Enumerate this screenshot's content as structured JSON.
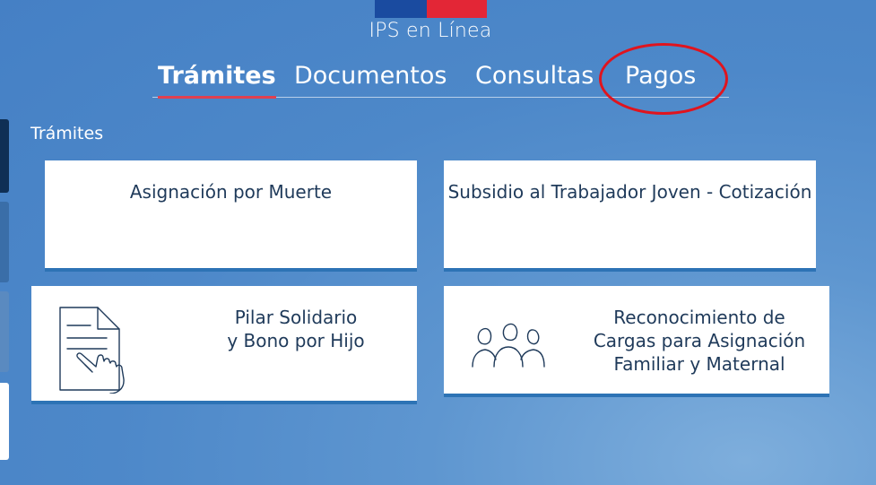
{
  "brand": {
    "title": "IPS en Línea"
  },
  "nav": {
    "tabs": [
      {
        "label": "Trámites",
        "active": true
      },
      {
        "label": "Documentos",
        "active": false
      },
      {
        "label": "Consultas",
        "active": false
      },
      {
        "label": "Pagos",
        "active": false
      }
    ]
  },
  "section": {
    "title": "Trámites"
  },
  "cards": {
    "asignacion": {
      "label": "Asignación por Muerte"
    },
    "subsidio": {
      "label": "Subsidio al Trabajador Joven - Cotización"
    },
    "pilar": {
      "line1": "Pilar Solidario",
      "line2": "y Bono por Hijo",
      "icon": "document-hand-icon"
    },
    "reconocimiento": {
      "line1": "Reconocimiento de",
      "line2": "Cargas para Asignación",
      "line3": "Familiar y Maternal",
      "icon": "family-icon"
    }
  },
  "colors": {
    "background": "#4d88c9",
    "flag_blue": "#1a4ba0",
    "flag_red": "#e32636",
    "active_underline": "#e04050",
    "highlight": "#e0141e",
    "card_text": "#1f3a5a"
  }
}
